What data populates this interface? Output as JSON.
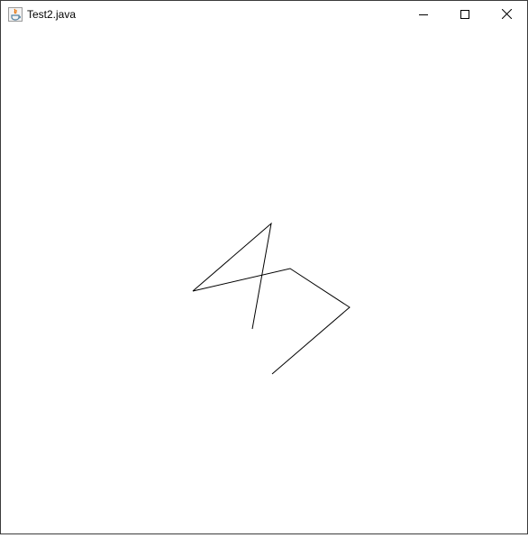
{
  "window": {
    "title": "Test2.java",
    "icons": {
      "app": "java-cup-icon",
      "minimize": "minimize-icon",
      "maximize": "maximize-icon",
      "close": "close-icon"
    },
    "colors": {
      "background": "#ffffff",
      "line": "#000000",
      "icon_orange": "#e76f00",
      "icon_blue": "#5382a1"
    }
  }
}
